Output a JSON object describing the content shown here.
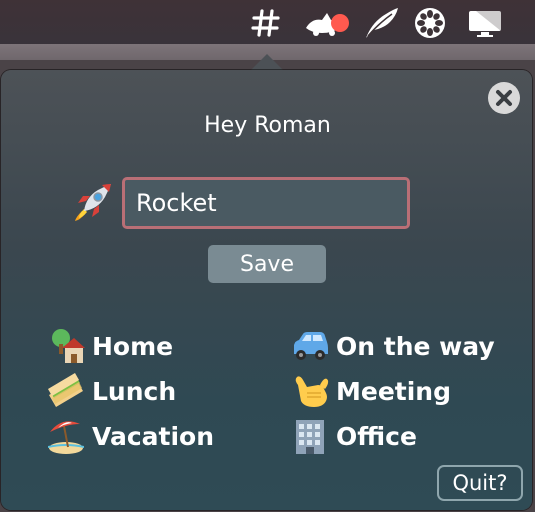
{
  "menubar": {
    "icons": [
      "slack-hash-icon",
      "cat-tray-icon",
      "feather-icon",
      "flower-icon",
      "display-icon"
    ],
    "badge_color": "#ff5a4f"
  },
  "popover": {
    "greeting": "Hey Roman",
    "status_icon": "rocket-icon",
    "status_input_value": "Rocket",
    "save_label": "Save",
    "quit_label": "Quit?",
    "presets": [
      {
        "icon": "house-with-tree-icon",
        "label": "Home"
      },
      {
        "icon": "car-icon",
        "label": "On the way"
      },
      {
        "icon": "sandwich-icon",
        "label": "Lunch"
      },
      {
        "icon": "call-me-hand-icon",
        "label": "Meeting"
      },
      {
        "icon": "beach-umbrella-icon",
        "label": "Vacation"
      },
      {
        "icon": "office-building-icon",
        "label": "Office"
      }
    ]
  },
  "colors": {
    "input_border": "#b96f76",
    "save_button": "#7a8b93",
    "quit_border": "#8fa6ad"
  }
}
